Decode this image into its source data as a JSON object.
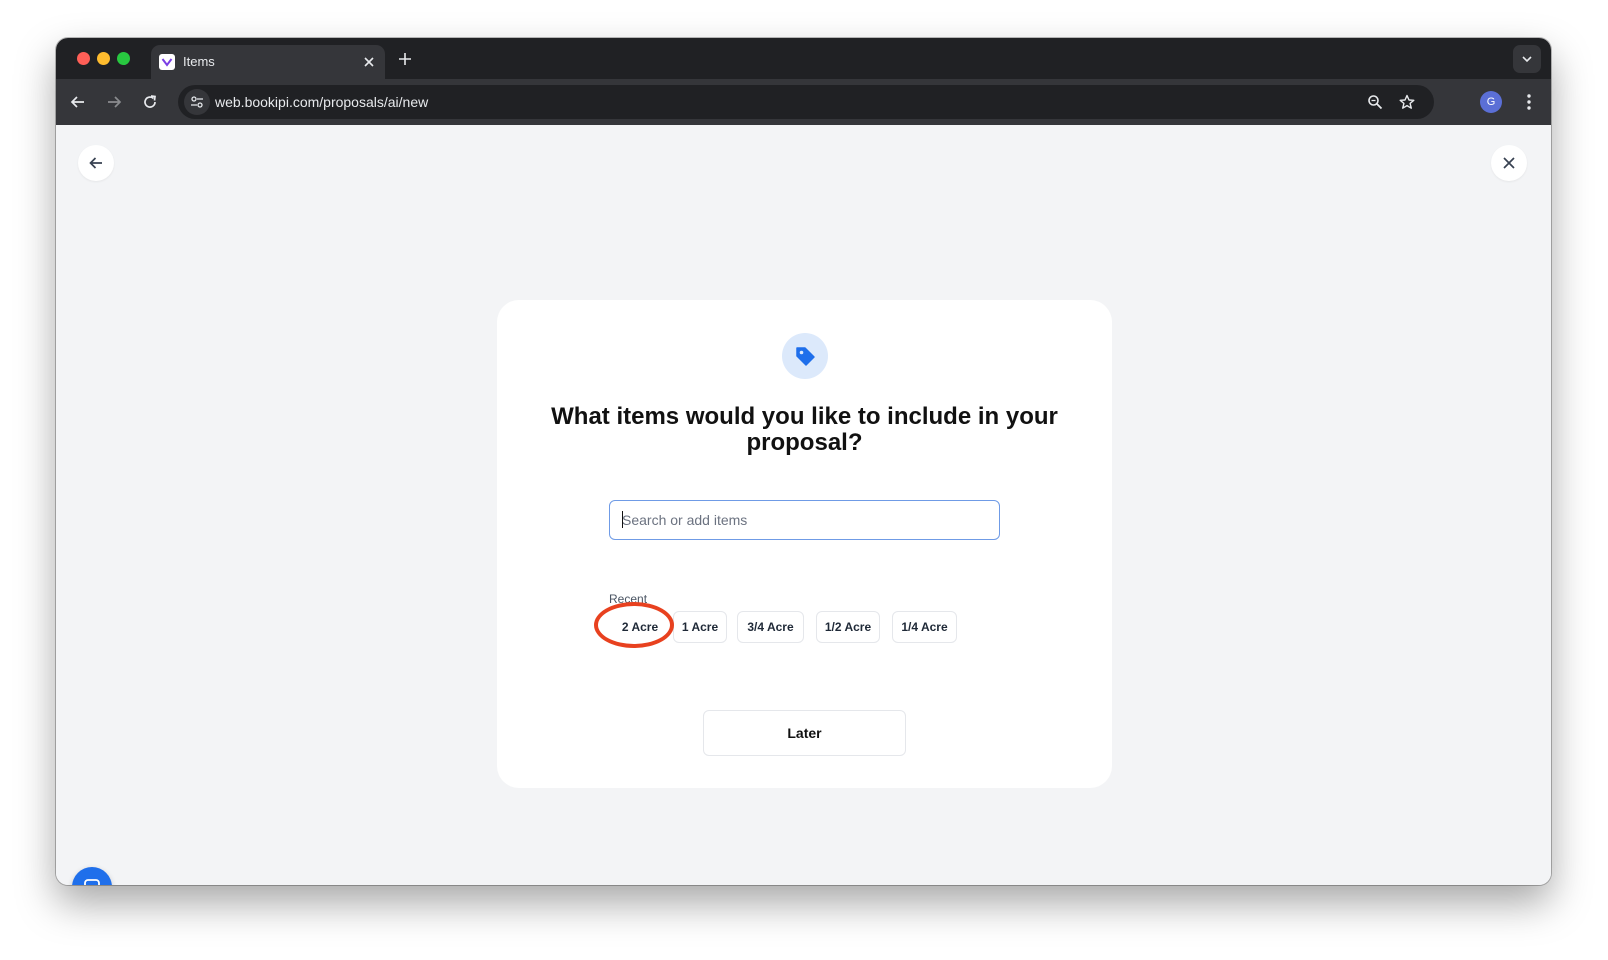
{
  "browser": {
    "tab_title": "Items",
    "url": "web.bookipi.com/proposals/ai/new",
    "profile_initial": "G",
    "icons": [
      "back-icon",
      "forward-icon",
      "reload-icon",
      "site-info-icon",
      "zoom-icon",
      "bookmark-star-icon",
      "more-icon"
    ]
  },
  "page": {
    "title": "What items would you like to include in your proposal?",
    "search": {
      "placeholder": "Search or add items",
      "value": ""
    },
    "recent_label": "Recent",
    "recent_items": [
      "2 Acre",
      "1 Acre",
      "3/4 Acre",
      "1/2 Acre",
      "1/4 Acre"
    ],
    "later_label": "Later",
    "icons": [
      "arrow-left-icon",
      "close-icon",
      "price-tag-icon",
      "chat-icon"
    ]
  },
  "colors": {
    "accent": "#1f6feb",
    "tag_circle": "#dce9fb",
    "highlight": "#e8411f",
    "page_bg": "#f3f4f6"
  }
}
